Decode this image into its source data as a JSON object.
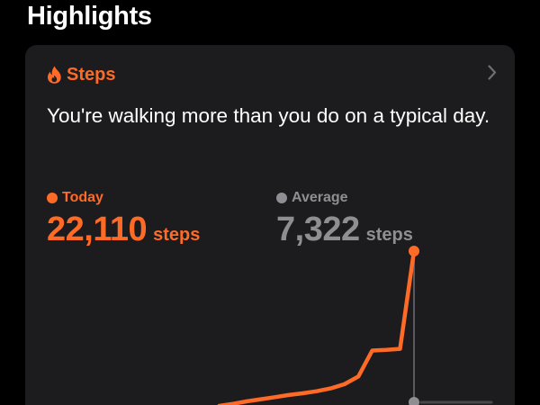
{
  "page": {
    "section_title": "Highlights"
  },
  "card": {
    "label": "Steps",
    "icon": "flame-icon",
    "chevron_icon": "chevron-right-icon",
    "headline": "You're walking more than you do on a typical day."
  },
  "today": {
    "label": "Today",
    "value": "22,110",
    "unit": "steps"
  },
  "average": {
    "label": "Average",
    "value": "7,322",
    "unit": "steps"
  },
  "colors": {
    "background": "#000000",
    "card": "#1c1c1e",
    "accent": "#ff6a26",
    "muted": "#8e8e93",
    "text": "#ffffff"
  },
  "chart_data": {
    "type": "line",
    "series": [
      {
        "name": "Today",
        "values": [
          0,
          0,
          0,
          0,
          0,
          0,
          0,
          0,
          0,
          0,
          0,
          0,
          0,
          300,
          650,
          950,
          1250,
          1550,
          1800,
          2100,
          2500,
          3100,
          4200,
          7900,
          8000,
          8150,
          22110
        ]
      }
    ],
    "average_total": 7322,
    "ylim": [
      0,
      24000
    ]
  }
}
